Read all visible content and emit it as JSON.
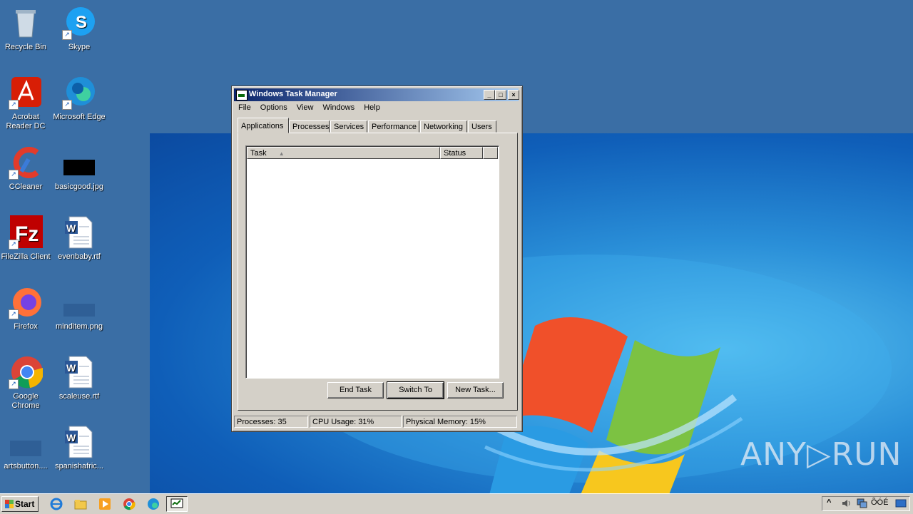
{
  "desktop": {
    "icons": [
      {
        "label": "Recycle Bin"
      },
      {
        "label": "Skype"
      },
      {
        "label": "Acrobat Reader DC"
      },
      {
        "label": "Microsoft Edge"
      },
      {
        "label": "CCleaner"
      },
      {
        "label": "basicgood.jpg"
      },
      {
        "label": "FileZilla Client"
      },
      {
        "label": "evenbaby.rtf"
      },
      {
        "label": "Firefox"
      },
      {
        "label": "minditem.png"
      },
      {
        "label": "Google Chrome"
      },
      {
        "label": "scaleuse.rtf"
      },
      {
        "label": "artsbutton...."
      },
      {
        "label": "spanishafric..."
      }
    ]
  },
  "window": {
    "title": "Windows Task Manager",
    "minimize": "_",
    "maximize": "□",
    "close": "×",
    "menu": [
      "File",
      "Options",
      "View",
      "Windows",
      "Help"
    ],
    "tabs": [
      "Applications",
      "Processes",
      "Services",
      "Performance",
      "Networking",
      "Users"
    ],
    "active_tab": "Applications",
    "columns": {
      "task": "Task",
      "status": "Status"
    },
    "sort_glyph": "▲",
    "buttons": {
      "end_task": "End Task",
      "switch_to": "Switch To",
      "new_task": "New Task..."
    },
    "status": {
      "processes": "Processes: 35",
      "cpu": "CPU Usage: 31%",
      "memory": "Physical Memory: 15%"
    }
  },
  "taskbar": {
    "start_label": "Start",
    "tray_time": "ÕÓÉ",
    "tray_chevron": "^"
  },
  "watermark": "ANY▷RUN"
}
